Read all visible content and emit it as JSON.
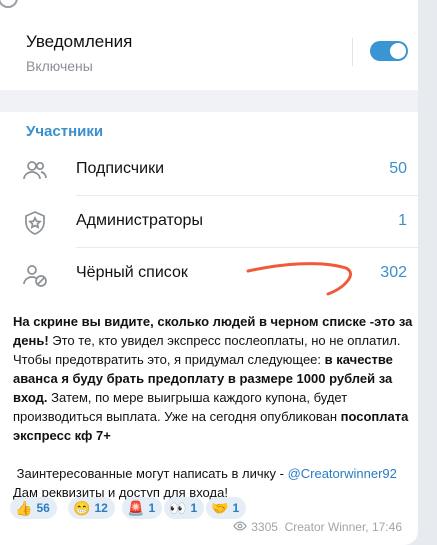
{
  "notifications": {
    "title": "Уведомления",
    "status": "Включены",
    "enabled": true
  },
  "members": {
    "section_title": "Участники",
    "rows": [
      {
        "label": "Подписчики",
        "count": "50",
        "icon": "subscribers-icon"
      },
      {
        "label": "Администраторы",
        "count": "1",
        "icon": "admin-shield-icon"
      },
      {
        "label": "Чёрный список",
        "count": "302",
        "icon": "blacklist-icon"
      }
    ]
  },
  "post": {
    "p1_bold": "На скрине вы видите, сколько людей в черном списке -это за день!",
    "p1_a": " Это те, кто увидел экспресс послеоплаты, но не оплатил. Чтобы предотвратить это, я придумал следующее: ",
    "p1_bold2": "в качестве аванса я буду брать предоплату в размере 1000 рублей за вход.",
    "p1_b": " Затем, по мере выигрыша каждого купона, будет производиться выплата. Уже на сегодня опубликован ",
    "p1_bold3": "посоплата экспресс кф 7+",
    "p2": "Заинтересованные могут написать в личку - ",
    "p2_link": "@Creatorwinner92",
    "p3": "Дам реквизиты и доступ для входа!"
  },
  "reactions": [
    {
      "emoji": "👍",
      "count": "56"
    },
    {
      "emoji": "😁",
      "count": "12"
    },
    {
      "emoji": "🚨",
      "count": "1"
    },
    {
      "emoji": "👀",
      "count": "1"
    },
    {
      "emoji": "🤝",
      "count": "1"
    }
  ],
  "meta": {
    "views": "3305",
    "author_time": "Creator Winner, 17:46"
  },
  "colors": {
    "accent": "#3a8fcc",
    "toggle": "#3a95d3",
    "annotation": "#f05a3a"
  }
}
